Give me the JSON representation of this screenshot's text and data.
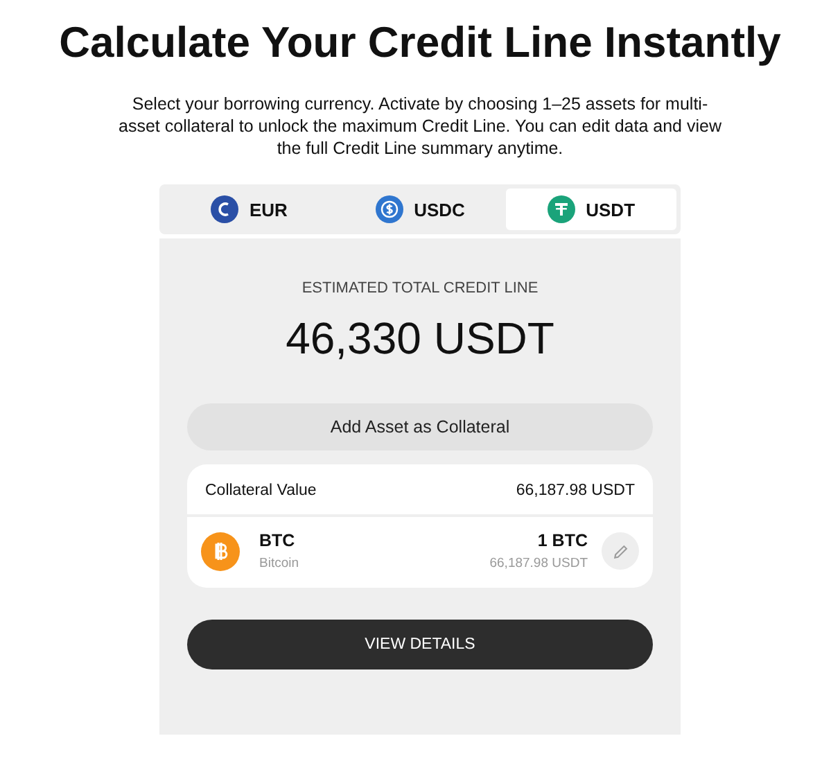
{
  "title": "Calculate Your Credit Line Instantly",
  "description": "Select your borrowing currency. Activate by choosing 1–25 assets for multi-asset collateral to unlock the maximum Credit Line. You can edit data and view the full Credit Line summary anytime.",
  "tabs": [
    {
      "label": "EUR",
      "kind": "eur",
      "selected": false
    },
    {
      "label": "USDC",
      "kind": "usdc",
      "selected": false
    },
    {
      "label": "USDT",
      "kind": "usdt",
      "selected": true
    }
  ],
  "estimate": {
    "label": "ESTIMATED TOTAL CREDIT LINE",
    "value": "46,330 USDT"
  },
  "add_button": "Add Asset as Collateral",
  "collateral": {
    "label": "Collateral Value",
    "value": "66,187.98 USDT",
    "assets": [
      {
        "kind": "btc",
        "symbol": "BTC",
        "name": "Bitcoin",
        "amount": "1 BTC",
        "value": "66,187.98 USDT"
      }
    ]
  },
  "details_button": "VIEW DETAILS"
}
